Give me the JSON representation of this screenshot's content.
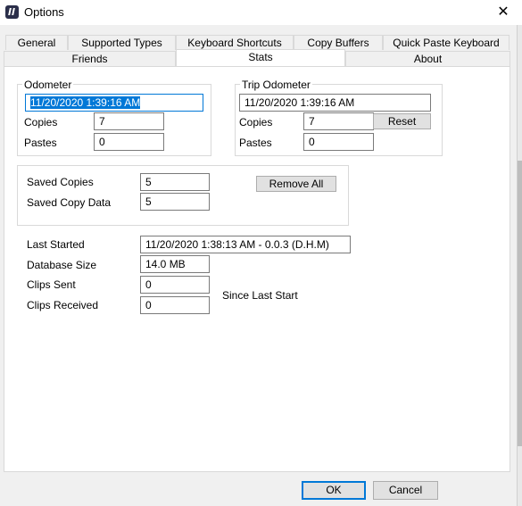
{
  "window": {
    "title": "Options",
    "close_glyph": "✕"
  },
  "tabs": {
    "row1": [
      "General",
      "Supported Types",
      "Keyboard Shortcuts",
      "Copy Buffers",
      "Quick Paste Keyboard"
    ],
    "row2": [
      "Friends",
      "Stats",
      "About"
    ],
    "active": "Stats"
  },
  "odometer": {
    "group_label": "Odometer",
    "date_value": "11/20/2020 1:39:16 AM",
    "copies_label": "Copies",
    "copies_value": "7",
    "pastes_label": "Pastes",
    "pastes_value": "0"
  },
  "trip_odometer": {
    "group_label": "Trip Odometer",
    "date_value": "11/20/2020 1:39:16 AM",
    "copies_label": "Copies",
    "copies_value": "7",
    "reset_label": "Reset",
    "pastes_label": "Pastes",
    "pastes_value": "0"
  },
  "saved": {
    "saved_copies_label": "Saved Copies",
    "saved_copies_value": "5",
    "saved_copy_data_label": "Saved Copy Data",
    "saved_copy_data_value": "5",
    "remove_all_label": "Remove All"
  },
  "info": {
    "last_started_label": "Last Started",
    "last_started_value": "11/20/2020 1:38:13 AM  -  0.0.3 (D.H.M)",
    "database_size_label": "Database Size",
    "database_size_value": "14.0 MB",
    "clips_sent_label": "Clips Sent",
    "clips_sent_value": "0",
    "clips_received_label": "Clips Received",
    "clips_received_value": "0",
    "since_last_start": "Since Last Start"
  },
  "footer": {
    "ok_label": "OK",
    "cancel_label": "Cancel"
  },
  "colors": {
    "accent": "#0078d7",
    "dialog_bg": "#f0f0f0",
    "panel_bg": "#ffffff"
  }
}
